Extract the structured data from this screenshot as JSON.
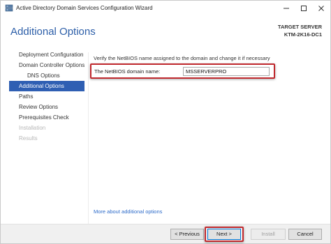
{
  "window": {
    "title": "Active Directory Domain Services Configuration Wizard",
    "icons": {
      "app": "server-icon",
      "minimize": "minimize-icon",
      "maximize": "maximize-icon",
      "close": "close-icon"
    }
  },
  "header": {
    "page_title": "Additional Options",
    "target_label": "TARGET SERVER",
    "target_name": "KTM-2K16-DC1"
  },
  "sidebar": {
    "items": [
      {
        "label": "Deployment Configuration",
        "state": "normal"
      },
      {
        "label": "Domain Controller Options",
        "state": "normal"
      },
      {
        "label": "DNS Options",
        "state": "normal",
        "indent": true
      },
      {
        "label": "Additional Options",
        "state": "active"
      },
      {
        "label": "Paths",
        "state": "normal"
      },
      {
        "label": "Review Options",
        "state": "normal"
      },
      {
        "label": "Prerequisites Check",
        "state": "normal"
      },
      {
        "label": "Installation",
        "state": "disabled"
      },
      {
        "label": "Results",
        "state": "disabled"
      }
    ]
  },
  "content": {
    "instruction": "Verify the NetBIOS name assigned to the domain and change it if necessary",
    "netbios_label": "The NetBIOS domain name:",
    "netbios_value": "MSSERVERPRO",
    "more_link": "More about additional options"
  },
  "footer": {
    "previous_label": "< Previous",
    "next_label": "Next >",
    "install_label": "Install",
    "cancel_label": "Cancel"
  },
  "colors": {
    "accent": "#2f5fb3",
    "title_blue": "#2c5ea8",
    "highlight_red": "#c0282d",
    "link_blue": "#2d6bc9"
  }
}
